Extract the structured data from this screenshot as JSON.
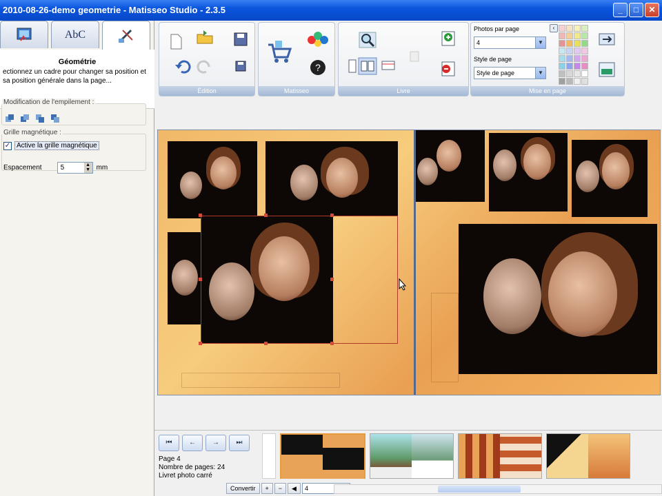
{
  "window": {
    "title": "2010-08-26-demo geometrie - Matisseo Studio - 2.3.5"
  },
  "left_panel": {
    "tabs": [
      {
        "icon": "photo-tab-icon"
      },
      {
        "label": "AbC",
        "icon": "text-tab-icon"
      },
      {
        "icon": "geometry-tab-icon"
      }
    ],
    "active_tab": "Géométrie",
    "description": "ectionnez un cadre pour changer sa position et sa position générale dans la page...",
    "stacking_group_label": "Modification de l'empilement :",
    "magnetic_group_label": "Grille magnétique :",
    "magnetic_checkbox_label": "Active la grille magnétique",
    "magnetic_checked": true,
    "spacing_label": "Espacement",
    "spacing_value": "5",
    "spacing_unit": "mm"
  },
  "toolbar": {
    "groups": [
      "Édition",
      "Matisseo",
      "Livre",
      "Mise en page"
    ],
    "photos_per_page_label": "Photos par page",
    "photos_per_page_value": "4",
    "page_style_label": "Style de page",
    "page_style_value": "Style de page",
    "palette_colors": [
      "#f7d1d1",
      "#f7e2c4",
      "#f6f2b8",
      "#d8f0c0",
      "#f0b7b7",
      "#f5cf98",
      "#f0ea8a",
      "#b9e7a5",
      "#e79494",
      "#f1b964",
      "#e8df5c",
      "#94d985",
      "#c7e8f2",
      "#c8d3f5",
      "#e3c8f2",
      "#f2c8e3",
      "#a7dcec",
      "#a7b8f0",
      "#d3a7ec",
      "#eca7d3",
      "#8dd1e6",
      "#8ea4eb",
      "#c289e6",
      "#e68fc5",
      "#c0c0c0",
      "#d8d8d8",
      "#e8e8e8",
      "#ffffff",
      "#a0a0a0",
      "#b8b8b8",
      "#f0f0f0",
      "#e0e0e0"
    ]
  },
  "navigator": {
    "page_label": "Page 4",
    "pages_label": "Nombre de pages: 24",
    "book_type": "Livret photo carré",
    "convert_label": "Convertir",
    "page_input": "4",
    "nav_buttons": [
      "first",
      "prev",
      "next",
      "last"
    ]
  },
  "colors": {
    "accent": "#0a55dd",
    "selection": "#b23a2c",
    "spread_bg": "#f0b868"
  }
}
